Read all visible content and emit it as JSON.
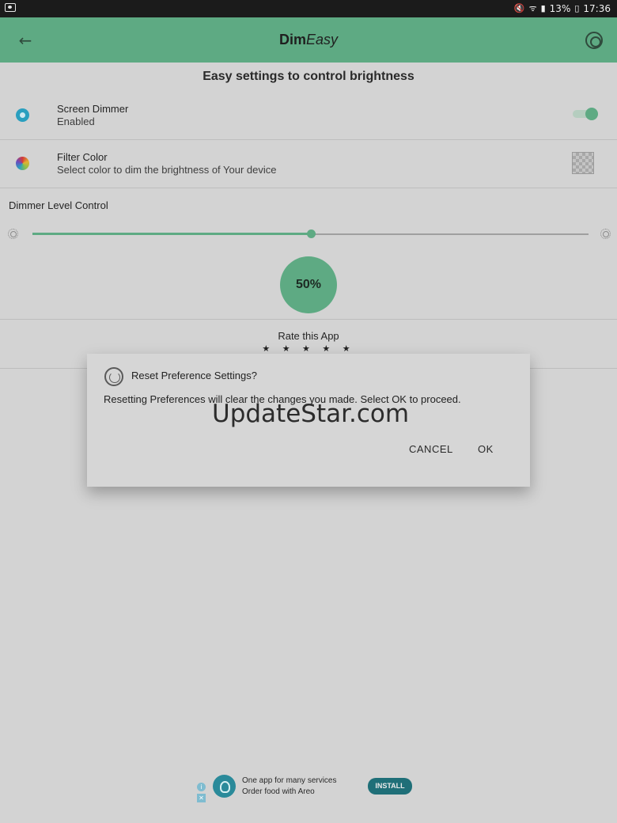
{
  "status_bar": {
    "battery": "13%",
    "time": "17:36",
    "icons": [
      "screenshot-icon",
      "mute-icon",
      "wifi-icon",
      "signal-icon",
      "battery-icon"
    ]
  },
  "app_bar": {
    "title_bold": "Dim",
    "title_italic": "Easy",
    "icons": [
      "back-arrow-icon",
      "reset-icon"
    ]
  },
  "main": {
    "headline": "Easy settings to control brightness",
    "screen_dimmer": {
      "title": "Screen Dimmer",
      "subtitle": "Enabled",
      "toggle_on": true,
      "icon": "sun-icon"
    },
    "filter_color": {
      "title": "Filter Color",
      "subtitle": "Select color to dim the brightness of Your device",
      "icon": "color-wheel-icon"
    },
    "dimmer_level": {
      "label": "Dimmer Level Control",
      "percent_label": "50%",
      "value": 0.5
    },
    "rate": {
      "label": "Rate this App",
      "stars": "★ ★ ★ ★ ★"
    }
  },
  "dialog": {
    "title": "Reset Preference Settings?",
    "message": "Resetting Preferences will clear the changes you made. Select OK to proceed.",
    "watermark": "UpdateStar.com",
    "cancel_label": "CANCEL",
    "ok_label": "OK"
  },
  "ad": {
    "line1": "One app for many services",
    "line2": "Order food with Areo",
    "install_label": "INSTALL",
    "info_glyph": "i",
    "close_glyph": "✕"
  },
  "colors": {
    "accent": "#5eaa83",
    "scrim_background": "#d3d3d3",
    "ad_button": "#1f6f78"
  }
}
